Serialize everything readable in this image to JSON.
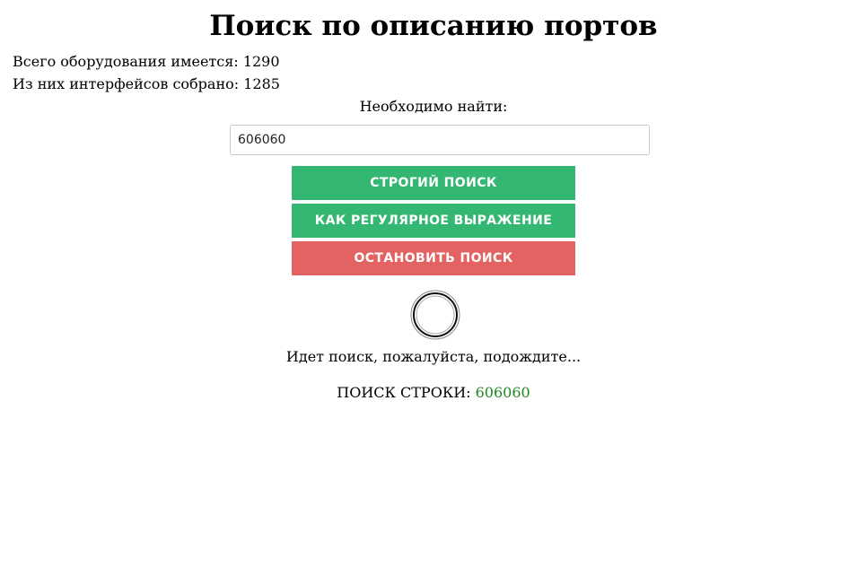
{
  "page": {
    "title": "Поиск по описанию портов"
  },
  "stats": {
    "total_equipment": "Всего оборудования имеется: 1290",
    "interfaces_collected": "Из них интерфейсов собрано: 1285"
  },
  "search": {
    "prompt": "Необходимо найти:",
    "value": "606060"
  },
  "buttons": {
    "strict_label": "СТРОГИЙ ПОИСК",
    "regex_label": "КАК РЕГУЛЯРНОЕ ВЫРАЖЕНИЕ",
    "stop_label": "ОСТАНОВИТЬ ПОИСК"
  },
  "status": {
    "loading_text": "Идет поиск, пожалуйста, подождите...",
    "query_prefix": "ПОИСК СТРОКИ: ",
    "query_value": "606060"
  },
  "colors": {
    "primary_button": "#34b772",
    "stop_button": "#e36262",
    "query_value": "#1f8a1f"
  },
  "icons": {
    "spinner": "loading-spinner-icon"
  }
}
